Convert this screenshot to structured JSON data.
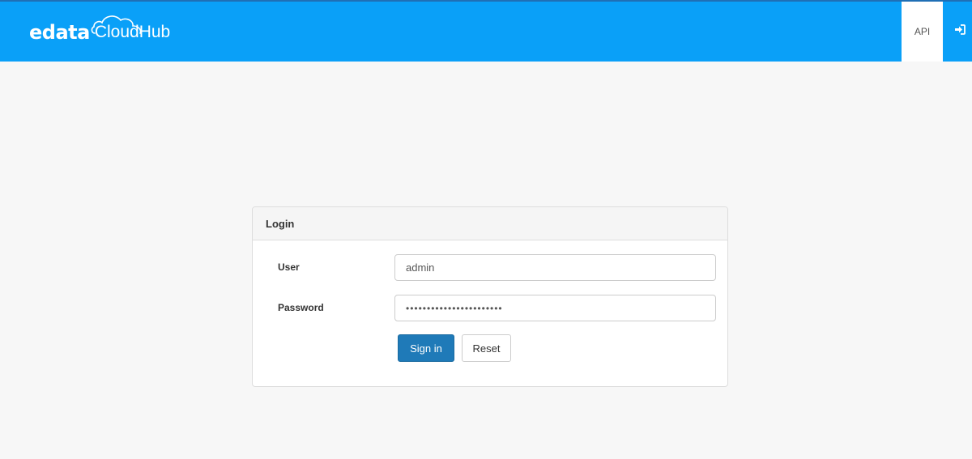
{
  "header": {
    "logo_brand": "edata",
    "logo_product": "CloudHub",
    "nav": {
      "api_label": "API",
      "signin_icon": "sign-in-icon"
    }
  },
  "colors": {
    "header_bg": "#0aa0f8",
    "primary_button": "#1f7ab8",
    "page_bg": "#f7f7f7"
  },
  "login": {
    "title": "Login",
    "user_label": "User",
    "user_value": "admin",
    "password_label": "Password",
    "password_value": "•••••••••••••••••••••••",
    "sign_in_label": "Sign in",
    "reset_label": "Reset"
  }
}
